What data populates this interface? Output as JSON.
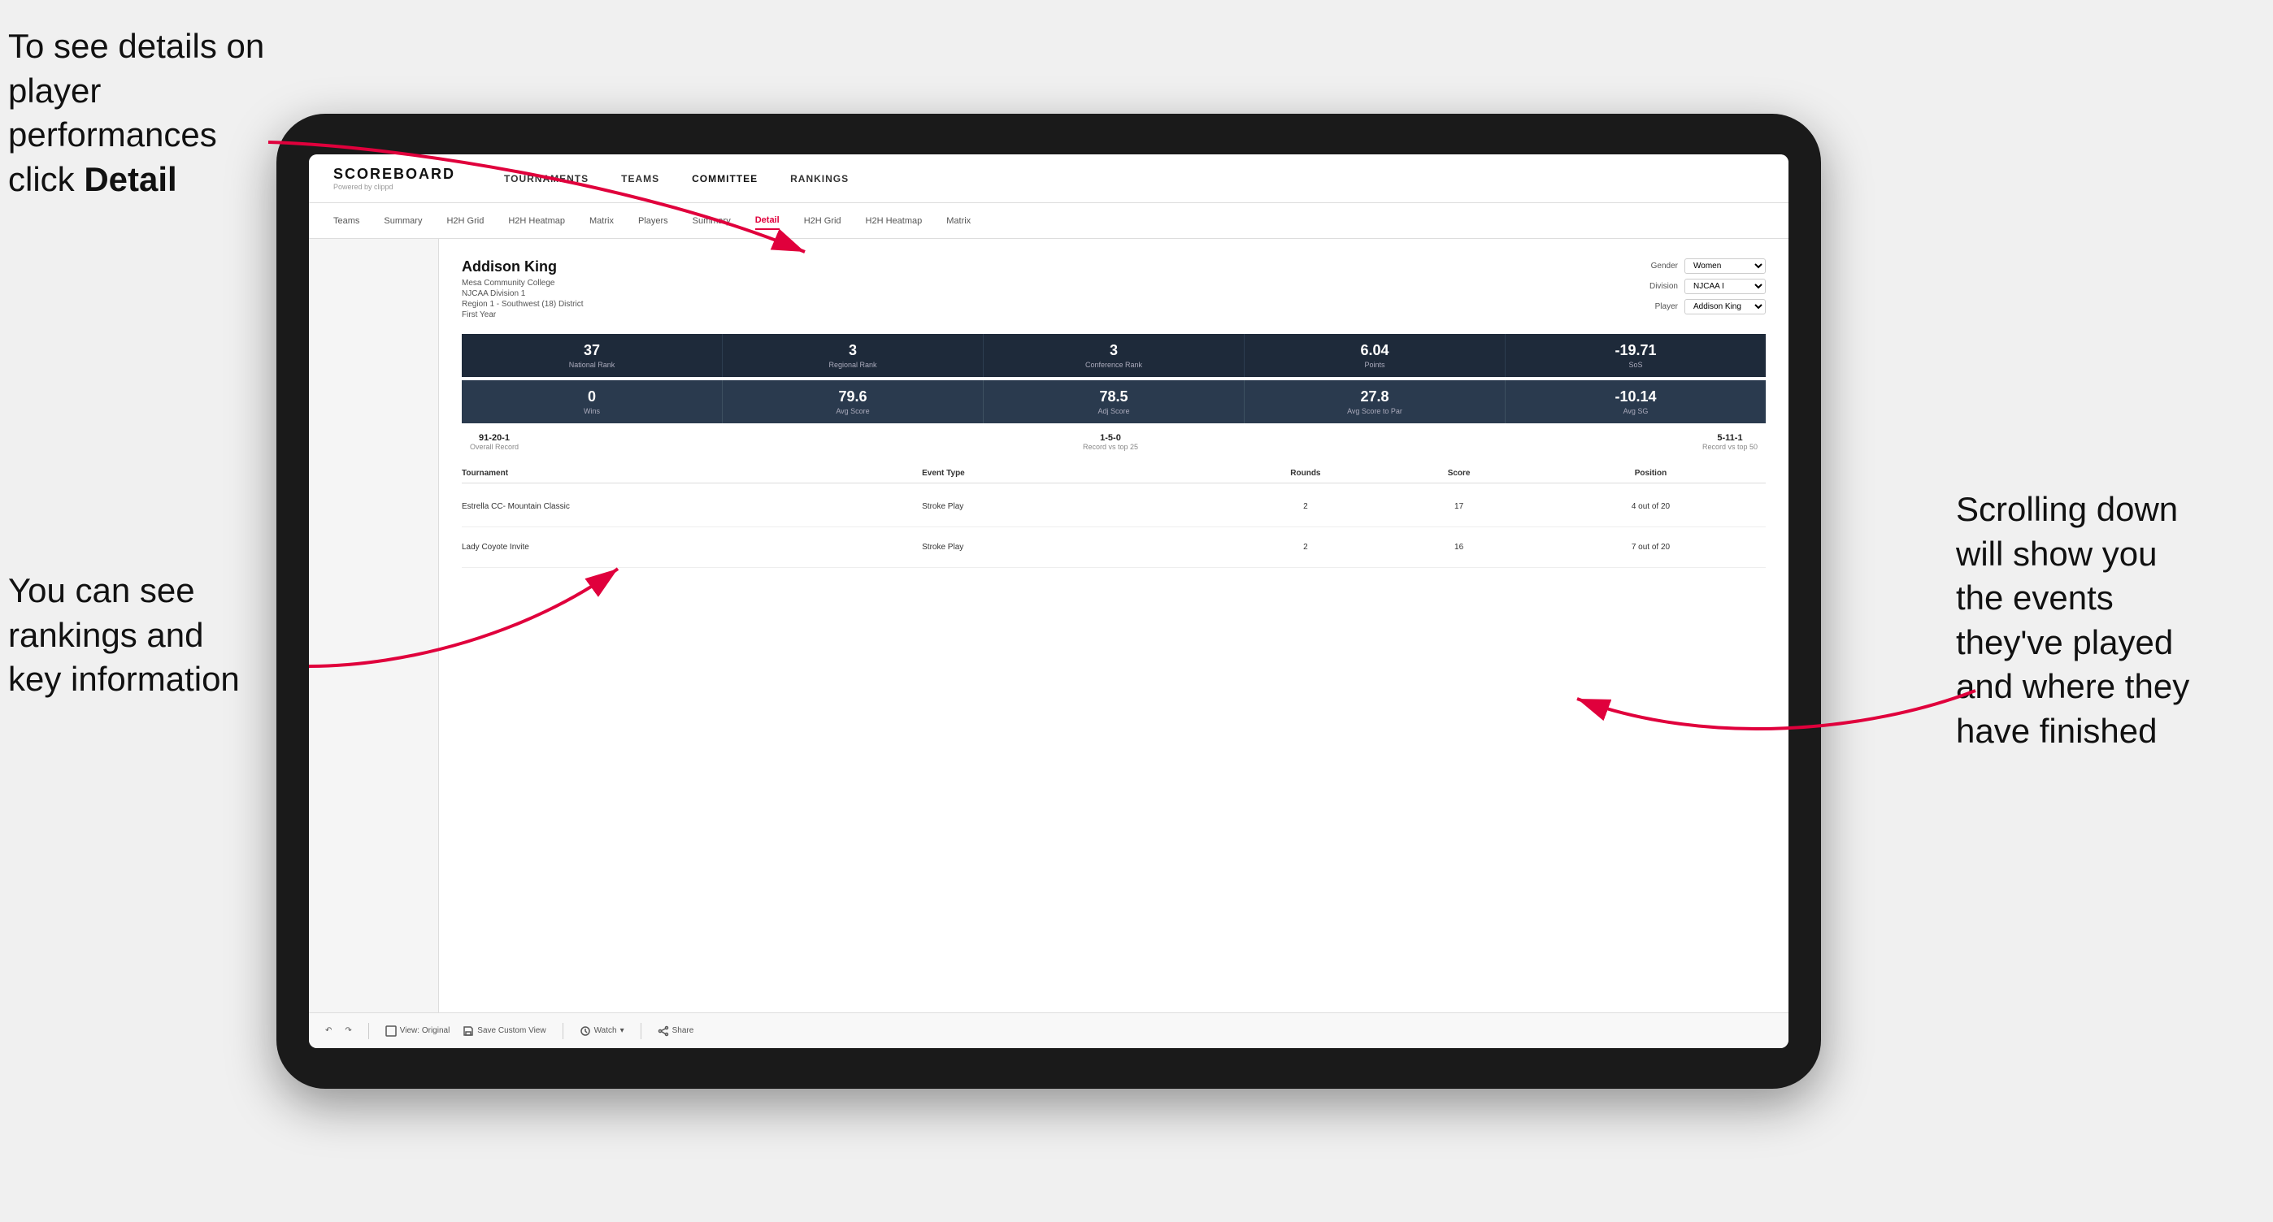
{
  "annotations": {
    "top_left_line1": "To see details on",
    "top_left_line2": "player performances",
    "top_left_line3": "click ",
    "top_left_bold": "Detail",
    "bottom_left_line1": "You can see",
    "bottom_left_line2": "rankings and",
    "bottom_left_line3": "key information",
    "right_line1": "Scrolling down",
    "right_line2": "will show you",
    "right_line3": "the events",
    "right_line4": "they've played",
    "right_line5": "and where they",
    "right_line6": "have finished"
  },
  "nav": {
    "logo": "SCOREBOARD",
    "logo_sub": "Powered by clippd",
    "items": [
      "TOURNAMENTS",
      "TEAMS",
      "COMMITTEE",
      "RANKINGS"
    ]
  },
  "sub_nav": {
    "items": [
      "Teams",
      "Summary",
      "H2H Grid",
      "H2H Heatmap",
      "Matrix",
      "Players",
      "Summary",
      "Detail",
      "H2H Grid",
      "H2H Heatmap",
      "Matrix"
    ],
    "active": "Detail"
  },
  "player": {
    "name": "Addison King",
    "college": "Mesa Community College",
    "division": "NJCAA Division 1",
    "region": "Region 1 - Southwest (18) District",
    "year": "First Year"
  },
  "filters": {
    "gender_label": "Gender",
    "gender_value": "Women",
    "division_label": "Division",
    "division_value": "NJCAA I",
    "player_label": "Player",
    "player_value": "Addison King"
  },
  "stats_row1": [
    {
      "value": "37",
      "label": "National Rank"
    },
    {
      "value": "3",
      "label": "Regional Rank"
    },
    {
      "value": "3",
      "label": "Conference Rank"
    },
    {
      "value": "6.04",
      "label": "Points"
    },
    {
      "value": "-19.71",
      "label": "SoS"
    }
  ],
  "stats_row2": [
    {
      "value": "0",
      "label": "Wins"
    },
    {
      "value": "79.6",
      "label": "Avg Score"
    },
    {
      "value": "78.5",
      "label": "Adj Score"
    },
    {
      "value": "27.8",
      "label": "Avg Score to Par"
    },
    {
      "value": "-10.14",
      "label": "Avg SG"
    }
  ],
  "records": [
    {
      "value": "91-20-1",
      "label": "Overall Record"
    },
    {
      "value": "1-5-0",
      "label": "Record vs top 25"
    },
    {
      "value": "5-11-1",
      "label": "Record vs top 50"
    }
  ],
  "table": {
    "headers": [
      "Tournament",
      "Event Type",
      "Rounds",
      "Score",
      "Position"
    ],
    "rows": [
      {
        "tournament": "Estrella CC- Mountain Classic",
        "event_type": "Stroke Play",
        "rounds": "2",
        "score": "17",
        "position": "4 out of 20"
      },
      {
        "tournament": "Lady Coyote Invite",
        "event_type": "Stroke Play",
        "rounds": "2",
        "score": "16",
        "position": "7 out of 20"
      }
    ]
  },
  "toolbar": {
    "items": [
      "View: Original",
      "Save Custom View",
      "Watch",
      "Share"
    ]
  }
}
